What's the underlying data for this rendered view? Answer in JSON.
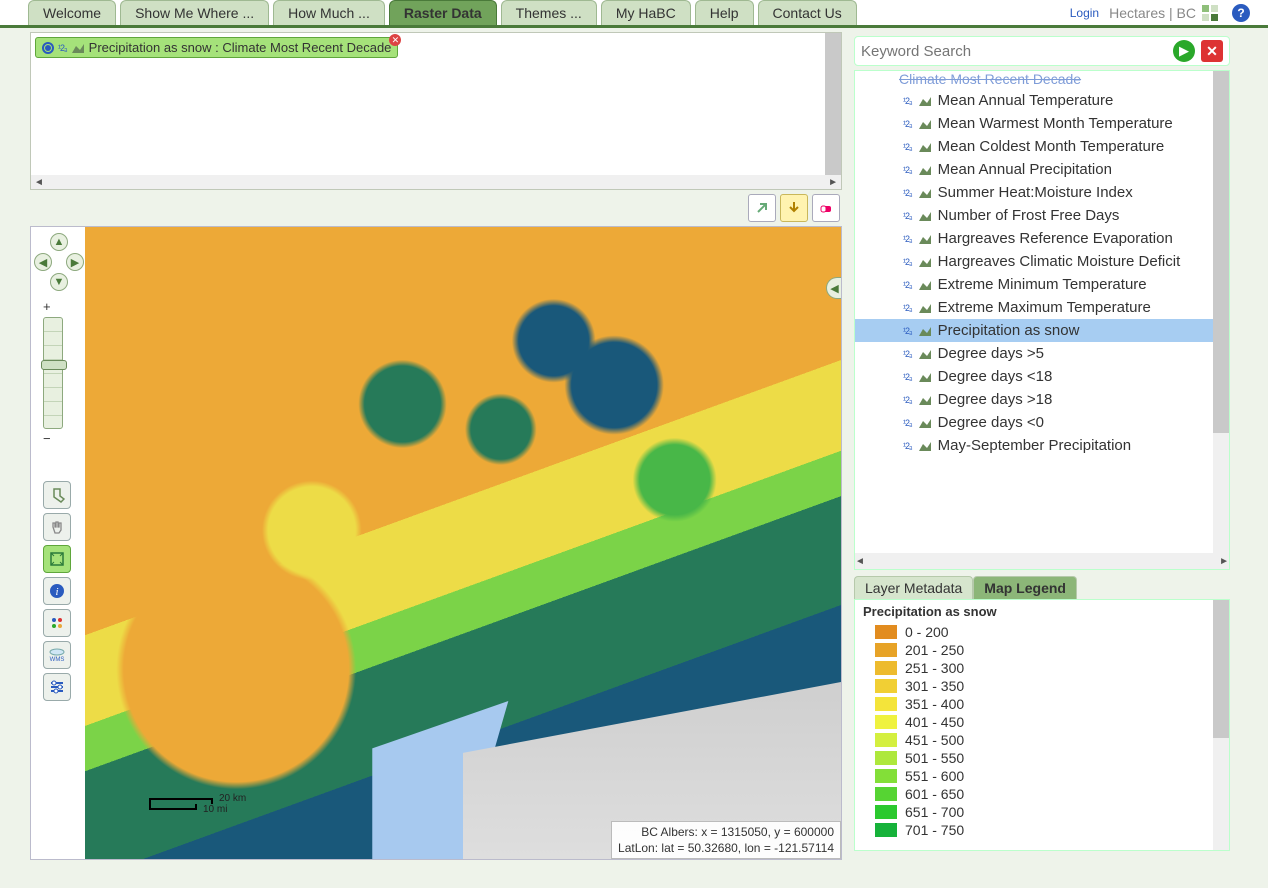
{
  "nav": {
    "tabs": [
      {
        "label": "Welcome"
      },
      {
        "label": "Show Me Where ..."
      },
      {
        "label": "How Much ..."
      },
      {
        "label": "Raster Data",
        "active": true
      },
      {
        "label": "Themes ..."
      },
      {
        "label": "My HaBC"
      },
      {
        "label": "Help"
      },
      {
        "label": "Contact Us"
      }
    ],
    "login": "Login",
    "brand": "Hectares | BC"
  },
  "selection": {
    "item_label": "Precipitation as snow : Climate Most Recent Decade"
  },
  "map_tools": {
    "link": "link-tool",
    "download": "download-tool",
    "erase": "erase-tool"
  },
  "pan": {
    "up": "▲",
    "down": "▼",
    "left": "◀",
    "right": "▶",
    "plus": "+",
    "minus": "−"
  },
  "side_tools": [
    {
      "name": "sock-tool",
      "active": false
    },
    {
      "name": "pan-hand-tool",
      "active": false
    },
    {
      "name": "extent-tool",
      "active": true
    },
    {
      "name": "identify-tool",
      "active": false
    },
    {
      "name": "cluster-tool",
      "active": false
    },
    {
      "name": "wms-tool",
      "active": false,
      "text": "WMS"
    },
    {
      "name": "settings-tool",
      "active": false
    }
  ],
  "scale": {
    "km": "20 km",
    "mi": "10 mi"
  },
  "coords": {
    "line1": "BC Albers: x = 1315050, y = 600000",
    "line2": "LatLon: lat = 50.32680, lon = -121.57114"
  },
  "search": {
    "placeholder": "Keyword Search"
  },
  "tree": {
    "parent_header": "Climate Most Recent Decade",
    "items": [
      {
        "label": "Mean Annual Temperature"
      },
      {
        "label": "Mean Warmest Month Temperature"
      },
      {
        "label": "Mean Coldest Month Temperature"
      },
      {
        "label": "Mean Annual Precipitation"
      },
      {
        "label": "Summer Heat:Moisture Index"
      },
      {
        "label": "Number of Frost Free Days"
      },
      {
        "label": "Hargreaves Reference Evaporation"
      },
      {
        "label": "Hargreaves Climatic Moisture Deficit"
      },
      {
        "label": "Extreme Minimum Temperature"
      },
      {
        "label": "Extreme Maximum Temperature"
      },
      {
        "label": "Precipitation as snow",
        "selected": true
      },
      {
        "label": "Degree days >5"
      },
      {
        "label": "Degree days <18"
      },
      {
        "label": "Degree days >18"
      },
      {
        "label": "Degree days <0"
      },
      {
        "label": "May-September Precipitation"
      }
    ]
  },
  "tabs2": [
    {
      "label": "Layer Metadata"
    },
    {
      "label": "Map Legend",
      "active": true
    }
  ],
  "legend": {
    "title": "Precipitation as snow",
    "rows": [
      {
        "range": "0 - 200",
        "color": "#e28c1f"
      },
      {
        "range": "201 - 250",
        "color": "#e7a327"
      },
      {
        "range": "251 - 300",
        "color": "#edbb2e"
      },
      {
        "range": "301 - 350",
        "color": "#f1cf34"
      },
      {
        "range": "351 - 400",
        "color": "#f4e43a"
      },
      {
        "range": "401 - 450",
        "color": "#eff23f"
      },
      {
        "range": "451 - 500",
        "color": "#d4ef3f"
      },
      {
        "range": "501 - 550",
        "color": "#aee83c"
      },
      {
        "range": "551 - 600",
        "color": "#83df38"
      },
      {
        "range": "601 - 650",
        "color": "#56d433"
      },
      {
        "range": "651 - 700",
        "color": "#2bc92e"
      },
      {
        "range": "701 - 750",
        "color": "#16b23a"
      }
    ]
  }
}
